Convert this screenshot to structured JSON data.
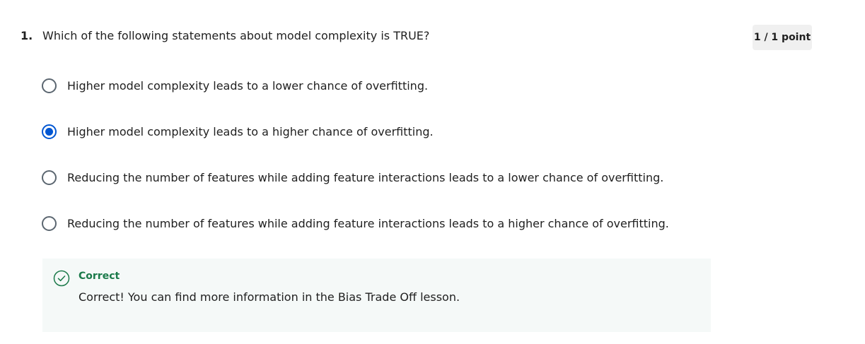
{
  "question": {
    "number": "1.",
    "text": "Which of the following statements about model complexity is TRUE?",
    "score": "1 / 1 point"
  },
  "options": [
    {
      "label": "Higher model complexity leads to a lower chance of overfitting.",
      "selected": false
    },
    {
      "label": "Higher model complexity leads to a higher chance of overfitting.",
      "selected": true
    },
    {
      "label": "Reducing the number of features while adding feature interactions leads to a lower chance of overfitting.",
      "selected": false
    },
    {
      "label": "Reducing the number of features while adding feature interactions leads to a higher chance of overfitting.",
      "selected": false
    }
  ],
  "feedback": {
    "icon": "check-circle-icon",
    "title": "Correct",
    "message": "Correct! You can find more information in the Bias Trade Off lesson."
  },
  "colors": {
    "accent": "#0056d2",
    "success": "#1b7a4a",
    "feedback_background": "#f5f9f8",
    "badge_background": "#f0f0f0"
  }
}
